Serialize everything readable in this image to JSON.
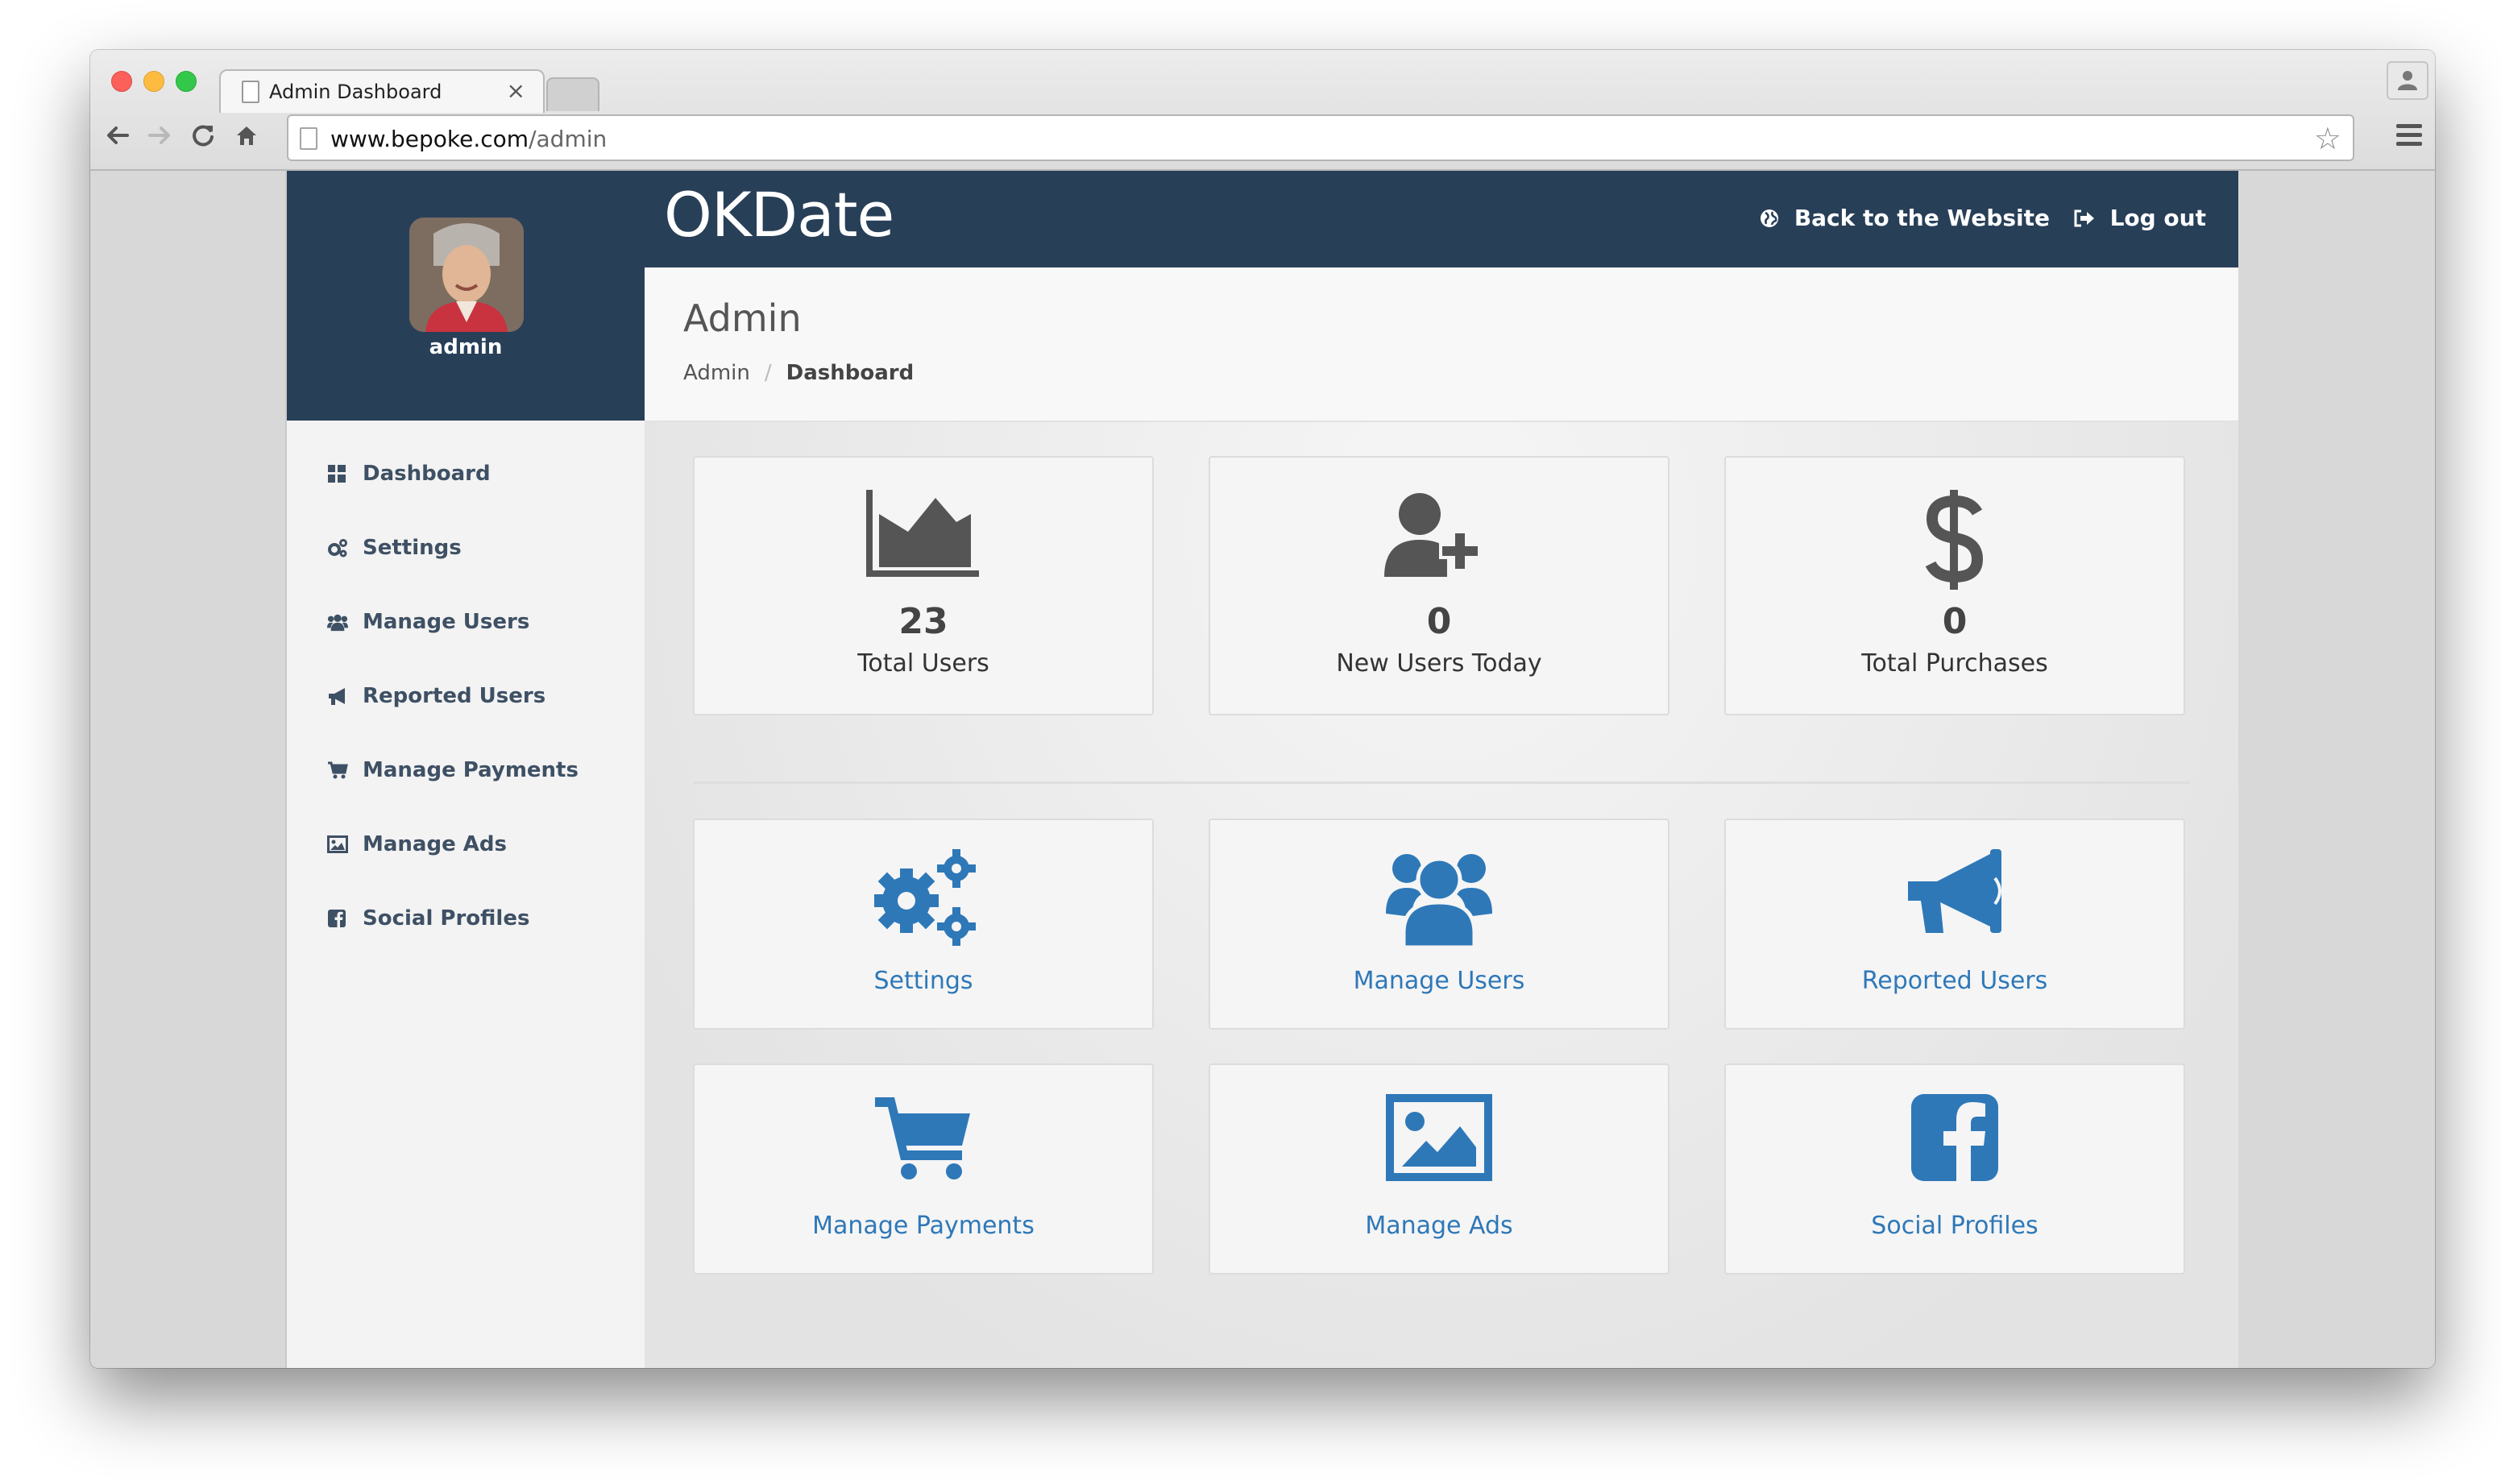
{
  "browser": {
    "tab_title": "Admin Dashboard",
    "tab_close": "×",
    "url_host": "www.bepoke.com",
    "url_path": "/admin",
    "star": "☆"
  },
  "sidebar": {
    "username": "admin",
    "items": [
      {
        "label": "Dashboard",
        "icon": "dashboard-icon"
      },
      {
        "label": "Settings",
        "icon": "cogs-icon"
      },
      {
        "label": "Manage Users",
        "icon": "users-icon"
      },
      {
        "label": "Reported Users",
        "icon": "bullhorn-icon"
      },
      {
        "label": "Manage Payments",
        "icon": "cart-icon"
      },
      {
        "label": "Manage Ads",
        "icon": "image-icon"
      },
      {
        "label": "Social Profiles",
        "icon": "facebook-icon"
      }
    ]
  },
  "header": {
    "brand": "OKDate",
    "back_link": "Back to the Website",
    "logout_link": "Log out"
  },
  "page": {
    "title": "Admin",
    "breadcrumb_root": "Admin",
    "breadcrumb_sep": "/",
    "breadcrumb_current": "Dashboard"
  },
  "stats": [
    {
      "value": "23",
      "label": "Total Users",
      "icon": "area-chart-icon"
    },
    {
      "value": "0",
      "label": "New Users Today",
      "icon": "user-plus-icon"
    },
    {
      "value": "0",
      "label": "Total Purchases",
      "icon": "dollar-icon"
    }
  ],
  "tiles": [
    {
      "label": "Settings",
      "icon": "cogs-icon"
    },
    {
      "label": "Manage Users",
      "icon": "users-icon"
    },
    {
      "label": "Reported Users",
      "icon": "bullhorn-icon"
    },
    {
      "label": "Manage Payments",
      "icon": "cart-icon"
    },
    {
      "label": "Manage Ads",
      "icon": "image-icon"
    },
    {
      "label": "Social Profiles",
      "icon": "facebook-icon"
    }
  ],
  "colors": {
    "header_bg": "#283f58",
    "link_blue": "#2e78b8",
    "stat_icon": "#555555"
  }
}
